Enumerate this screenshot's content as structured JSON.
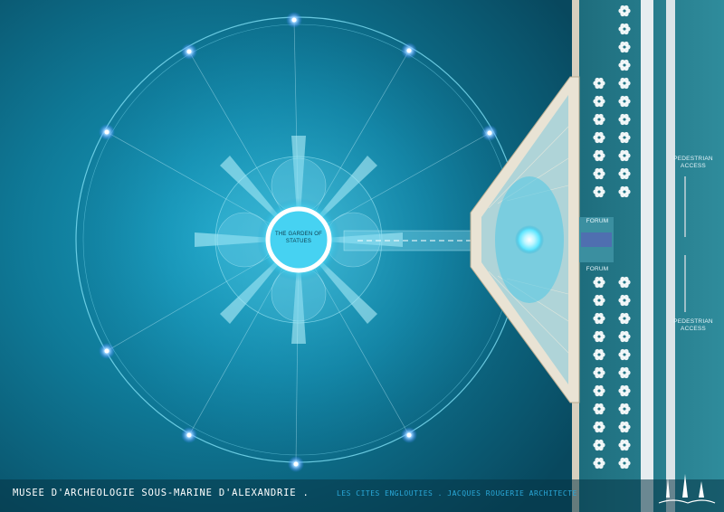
{
  "labels": {
    "garden": "THE GARDEN OF STATUES",
    "forum_top": "FORUM",
    "forum_bottom": "FORUM",
    "pedestrian_top": "PEDESTRIAN ACCESS",
    "pedestrian_bottom": "PEDESTRIAN ACCESS"
  },
  "footer": {
    "title": "MUSEE D'ARCHEOLOGIE SOUS-MARINE D'ALEXANDRIE .",
    "subtitle": "LES CITES ENGLOUTIES . JACQUES ROUGERIE ARCHITECTE"
  },
  "colors": {
    "water": "#0a4f66",
    "glow": "#5fe6ff",
    "quay": "#2d7b8a",
    "text": "#ffffff",
    "accent": "#2aa8d8"
  }
}
